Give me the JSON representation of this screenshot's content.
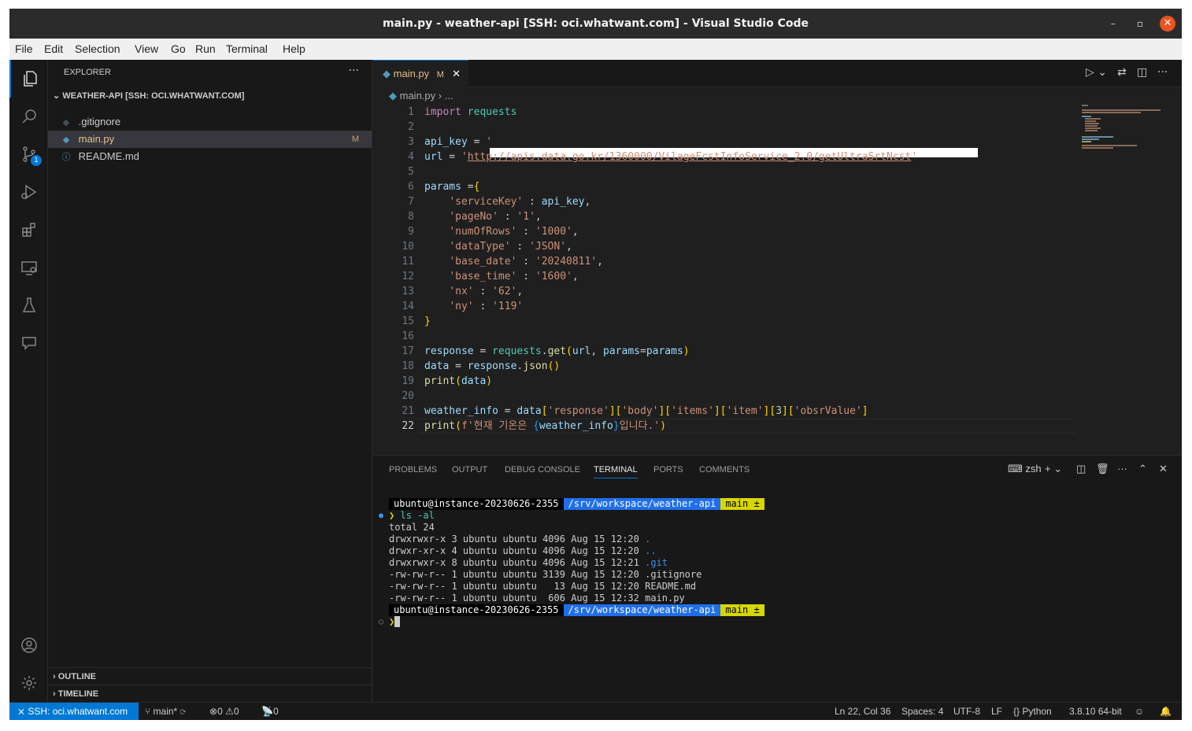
{
  "window": {
    "title": "main.py - weather-api [SSH: oci.whatwant.com] - Visual Studio Code",
    "minimize": "–",
    "maximize": "▫",
    "close": "✕"
  },
  "menu": [
    "File",
    "Edit",
    "Selection",
    "View",
    "Go",
    "Run",
    "Terminal",
    "Help"
  ],
  "activity": {
    "scm_badge": "1"
  },
  "explorer": {
    "title": "EXPLORER",
    "more": "···",
    "folder": "WEATHER-API [SSH: OCI.WHATWANT.COM]",
    "files": [
      {
        "name": ".gitignore",
        "icon": "git-icon",
        "status": ""
      },
      {
        "name": "main.py",
        "icon": "python-icon",
        "status": "M"
      },
      {
        "name": "README.md",
        "icon": "info-icon",
        "status": ""
      }
    ],
    "outline": "OUTLINE",
    "timeline": "TIMELINE"
  },
  "editor": {
    "tab": {
      "name": "main.py",
      "mod": "M"
    },
    "breadcrumb": {
      "file": "main.py",
      "rest": "..."
    },
    "line_numbers": [
      "1",
      "2",
      "3",
      "4",
      "5",
      "6",
      "7",
      "8",
      "9",
      "10",
      "11",
      "12",
      "13",
      "14",
      "15",
      "16",
      "17",
      "18",
      "19",
      "20",
      "21",
      "22"
    ],
    "current_line": "22",
    "code": {
      "import": "import",
      "requests": "requests",
      "api_key": "api_key",
      "eq": " = ",
      "url_var": "url",
      "url": "http://apis.data.go.kr/1360000/VilageFcstInfoService_2.0/getUltraSrtNcst",
      "params": "params",
      "p1k": "'serviceKey'",
      "p1v": "api_key",
      "p2k": "'pageNo'",
      "p2v": "'1'",
      "p3k": "'numOfRows'",
      "p3v": "'1000'",
      "p4k": "'dataType'",
      "p4v": "'JSON'",
      "p5k": "'base_date'",
      "p5v": "'20240811'",
      "p6k": "'base_time'",
      "p6v": "'1600'",
      "p7k": "'nx'",
      "p7v": "'62'",
      "p8k": "'ny'",
      "p8v": "'119'",
      "response": "response",
      "get": "get",
      "params_kw": "params",
      "data": "data",
      "json": "json",
      "print": "print",
      "weather_info": "weather_info",
      "k1": "'response'",
      "k2": "'body'",
      "k3": "'items'",
      "k4": "'item'",
      "idx": "3",
      "k5": "'obsrValue'",
      "fstr_a": "f'현재 기온은 ",
      "fstr_b": "입니다.'"
    }
  },
  "panel": {
    "tabs": [
      "PROBLEMS",
      "OUTPUT",
      "DEBUG CONSOLE",
      "TERMINAL",
      "PORTS",
      "COMMENTS"
    ],
    "active_tab": "TERMINAL",
    "shell": "zsh",
    "terminal": {
      "user": "ubuntu@instance-20230626-2355",
      "dir": "/srv/workspace/weather-api",
      "branch": "main ±",
      "cmd": "ls -al",
      "total": "total 24",
      "rows": [
        {
          "perm": "drwxrwxr-x 3 ubuntu ubuntu 4096 Aug 15 12:20 ",
          "name": ".",
          "dir": true
        },
        {
          "perm": "drwxr-xr-x 4 ubuntu ubuntu 4096 Aug 15 12:20 ",
          "name": "..",
          "dir": true
        },
        {
          "perm": "drwxrwxr-x 8 ubuntu ubuntu 4096 Aug 15 12:21 ",
          "name": ".git",
          "dir": true
        },
        {
          "perm": "-rw-rw-r-- 1 ubuntu ubuntu 3139 Aug 15 12:20 ",
          "name": ".gitignore",
          "dir": false
        },
        {
          "perm": "-rw-rw-r-- 1 ubuntu ubuntu   13 Aug 15 12:20 ",
          "name": "README.md",
          "dir": false
        },
        {
          "perm": "-rw-rw-r-- 1 ubuntu ubuntu  606 Aug 15 12:32 ",
          "name": "main.py",
          "dir": false
        }
      ]
    }
  },
  "status": {
    "remote": "SSH: oci.whatwant.com",
    "branch": "main*",
    "errors": "0",
    "warnings": "0",
    "ports": "0",
    "position": "Ln 22, Col 36",
    "spaces": "Spaces: 4",
    "encoding": "UTF-8",
    "eol": "LF",
    "language": "Python",
    "interpreter": "3.8.10 64-bit"
  },
  "colors": {
    "accent": "#0078d4",
    "modified": "#e2c08d",
    "close_button": "#e95420"
  }
}
